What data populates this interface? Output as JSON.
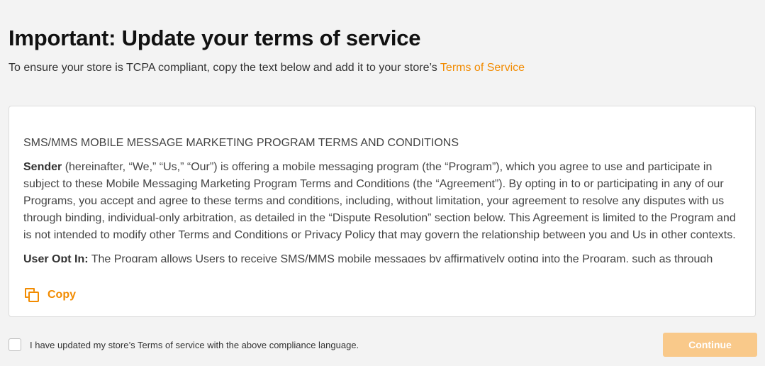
{
  "header": {
    "title": "Important: Update your terms of service",
    "subtitle_text": "To ensure your store is TCPA compliant, copy the text below and add it to your store’s ",
    "subtitle_link": "Terms of Service"
  },
  "terms": {
    "heading": "SMS/MMS MOBILE MESSAGE MARKETING PROGRAM TERMS AND CONDITIONS",
    "paragraphs": [
      {
        "lead": "Sender",
        "text": " (hereinafter, “We,” “Us,” “Our”) is offering a mobile messaging program (the “Program”), which you agree to use and participate in subject to these Mobile Messaging Marketing Program Terms and Conditions (the “Agreement”). By opting in to or participating in any of our Programs, you accept and agree to these terms and conditions, including, without limitation, your agreement to resolve any disputes with us through binding, individual-only arbitration, as detailed in the “Dispute Resolution” section below. This Agreement is limited to the Program and is not intended to modify other Terms and Conditions or Privacy Policy that may govern the relationship between you and Us in other contexts."
      },
      {
        "lead": "User Opt In:",
        "text": " The Program allows Users to receive SMS/MMS mobile messages by affirmatively opting into the Program, such as through online"
      }
    ]
  },
  "copy_button": {
    "label": "Copy",
    "icon": "copy-icon",
    "color": "#f28b00"
  },
  "footer": {
    "checkbox_label": "I have updated my store’s Terms of service with the above compliance language.",
    "checkbox_checked": false,
    "continue_label": "Continue"
  },
  "colors": {
    "accent": "#f28b00",
    "continue_disabled_bg": "#f9c98a",
    "page_bg": "#f3f3f3"
  }
}
